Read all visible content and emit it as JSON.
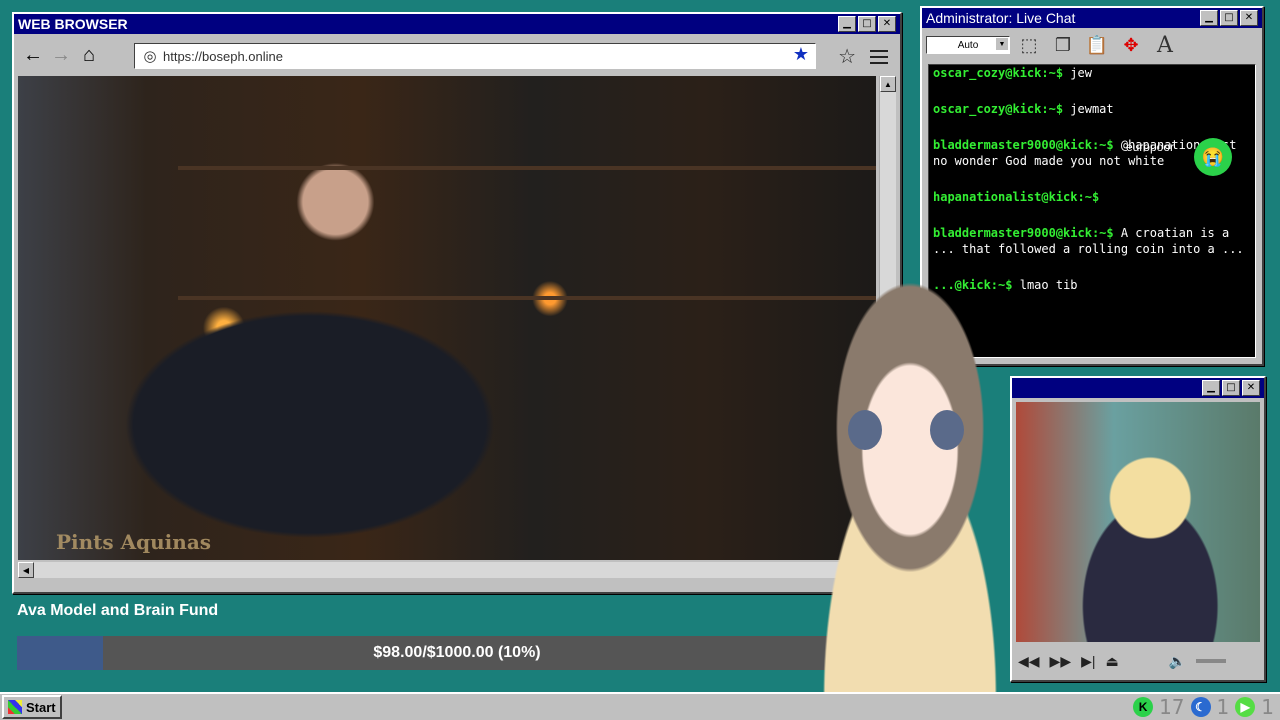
{
  "browser": {
    "title": "WEB BROWSER",
    "url": "https://boseph.online",
    "video_logo": "Pints Aquinas"
  },
  "fund": {
    "title": "Ava Model and Brain Fund",
    "progress_text": "$98.00/$1000.00 (10%)",
    "progress_fraction": 0.098
  },
  "chat": {
    "title": "Administrator: Live Chat",
    "font_size_option": "Auto",
    "messages": [
      {
        "user": "oscar_cozy@kick:~$",
        "text": "jew"
      },
      {
        "user": "oscar_cozy@kick:~$",
        "text": "jewmat"
      },
      {
        "user": "bladdermaster9000@kick:~$",
        "text": "@hapanationalist no wonder God made you not white"
      },
      {
        "user": "hapanationalist@kick:~$",
        "text": ""
      },
      {
        "user": "bladdermaster9000@kick:~$",
        "text": "A croatian is a ... that followed a rolling coin into a ..."
      },
      {
        "user": "...@kick:~$",
        "text": "lmao tib"
      }
    ],
    "emote_label": "europoor"
  },
  "taskbar": {
    "start_label": "Start",
    "tray_counts": [
      "17",
      "1",
      "1"
    ]
  },
  "colors": {
    "desktop": "#1a7f7a",
    "titlebar": "#000080",
    "chat_user": "#33ee33",
    "progress_fill": "#3e5a8a"
  }
}
